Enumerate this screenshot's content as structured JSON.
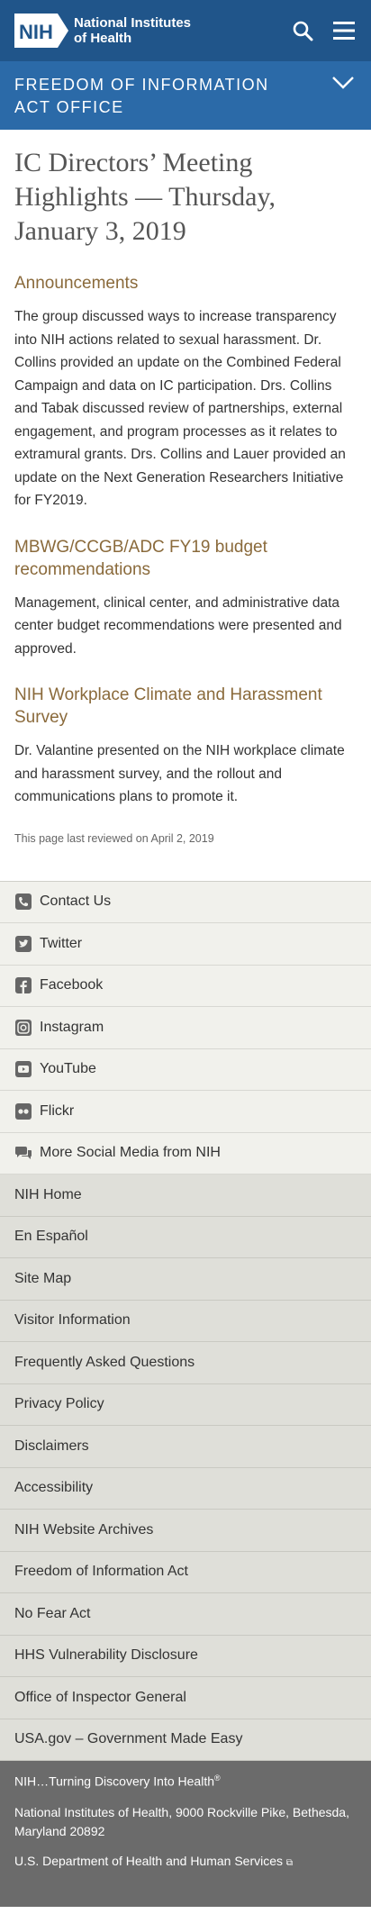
{
  "header": {
    "logo_acronym": "NIH",
    "logo_name": "National Institutes of Health",
    "search_icon": "search-icon",
    "menu_icon": "hamburger-menu-icon"
  },
  "office_bar": {
    "title": "FREEDOM OF INFORMATION ACT OFFICE",
    "toggle_icon": "chevron-down-icon"
  },
  "page": {
    "title": "IC Directors’ Meeting Highlights — Thursday, January 3, 2019",
    "sections": [
      {
        "heading": "Announcements",
        "text": "The group discussed ways to increase transparency into NIH actions related to sexual harassment. Dr. Collins provided an update on the Combined Federal Campaign and data on IC participation. Drs. Collins and Tabak discussed review of partnerships, external engagement, and program processes as it relates to extramural grants. Drs. Collins and Lauer provided an update on the Next Generation Researchers Initiative for FY2019."
      },
      {
        "heading": "MBWG/CCGB/ADC FY19 budget recommendations",
        "text": "Management, clinical center, and administrative data center budget recommendations were presented and approved."
      },
      {
        "heading": "NIH Workplace Climate and Harassment Survey",
        "text": "Dr. Valantine presented on the NIH workplace climate and harassment survey, and the rollout and communications plans to promote it."
      }
    ],
    "last_reviewed": "This page last reviewed on April 2, 2019"
  },
  "social": [
    {
      "label": "Contact Us",
      "icon": "phone-icon"
    },
    {
      "label": "Twitter",
      "icon": "twitter-icon"
    },
    {
      "label": "Facebook",
      "icon": "facebook-icon"
    },
    {
      "label": "Instagram",
      "icon": "instagram-icon"
    },
    {
      "label": "YouTube",
      "icon": "youtube-icon"
    },
    {
      "label": "Flickr",
      "icon": "flickr-icon"
    },
    {
      "label": "More Social Media from NIH",
      "icon": "chat-bubbles-icon"
    }
  ],
  "footer_links": [
    "NIH Home",
    "En Español",
    "Site Map",
    "Visitor Information",
    "Frequently Asked Questions",
    "Privacy Policy",
    "Disclaimers",
    "Accessibility",
    "NIH Website Archives",
    "Freedom of Information Act",
    "No Fear Act",
    "HHS Vulnerability Disclosure",
    "Office of Inspector General",
    "USA.gov – Government Made Easy"
  ],
  "bottom": {
    "tagline": "NIH…Turning Discovery Into Health",
    "tagline_mark": "®",
    "address": "National Institutes of Health, 9000 Rockville Pike, Bethesda, Maryland 20892",
    "hhs_link": "U.S. Department of Health and Human Services"
  },
  "colors": {
    "header_blue": "#20558a",
    "office_blue": "#2b6aa8",
    "heading_gold": "#8a6a3b",
    "footer_gray": "#6b6b6b"
  }
}
